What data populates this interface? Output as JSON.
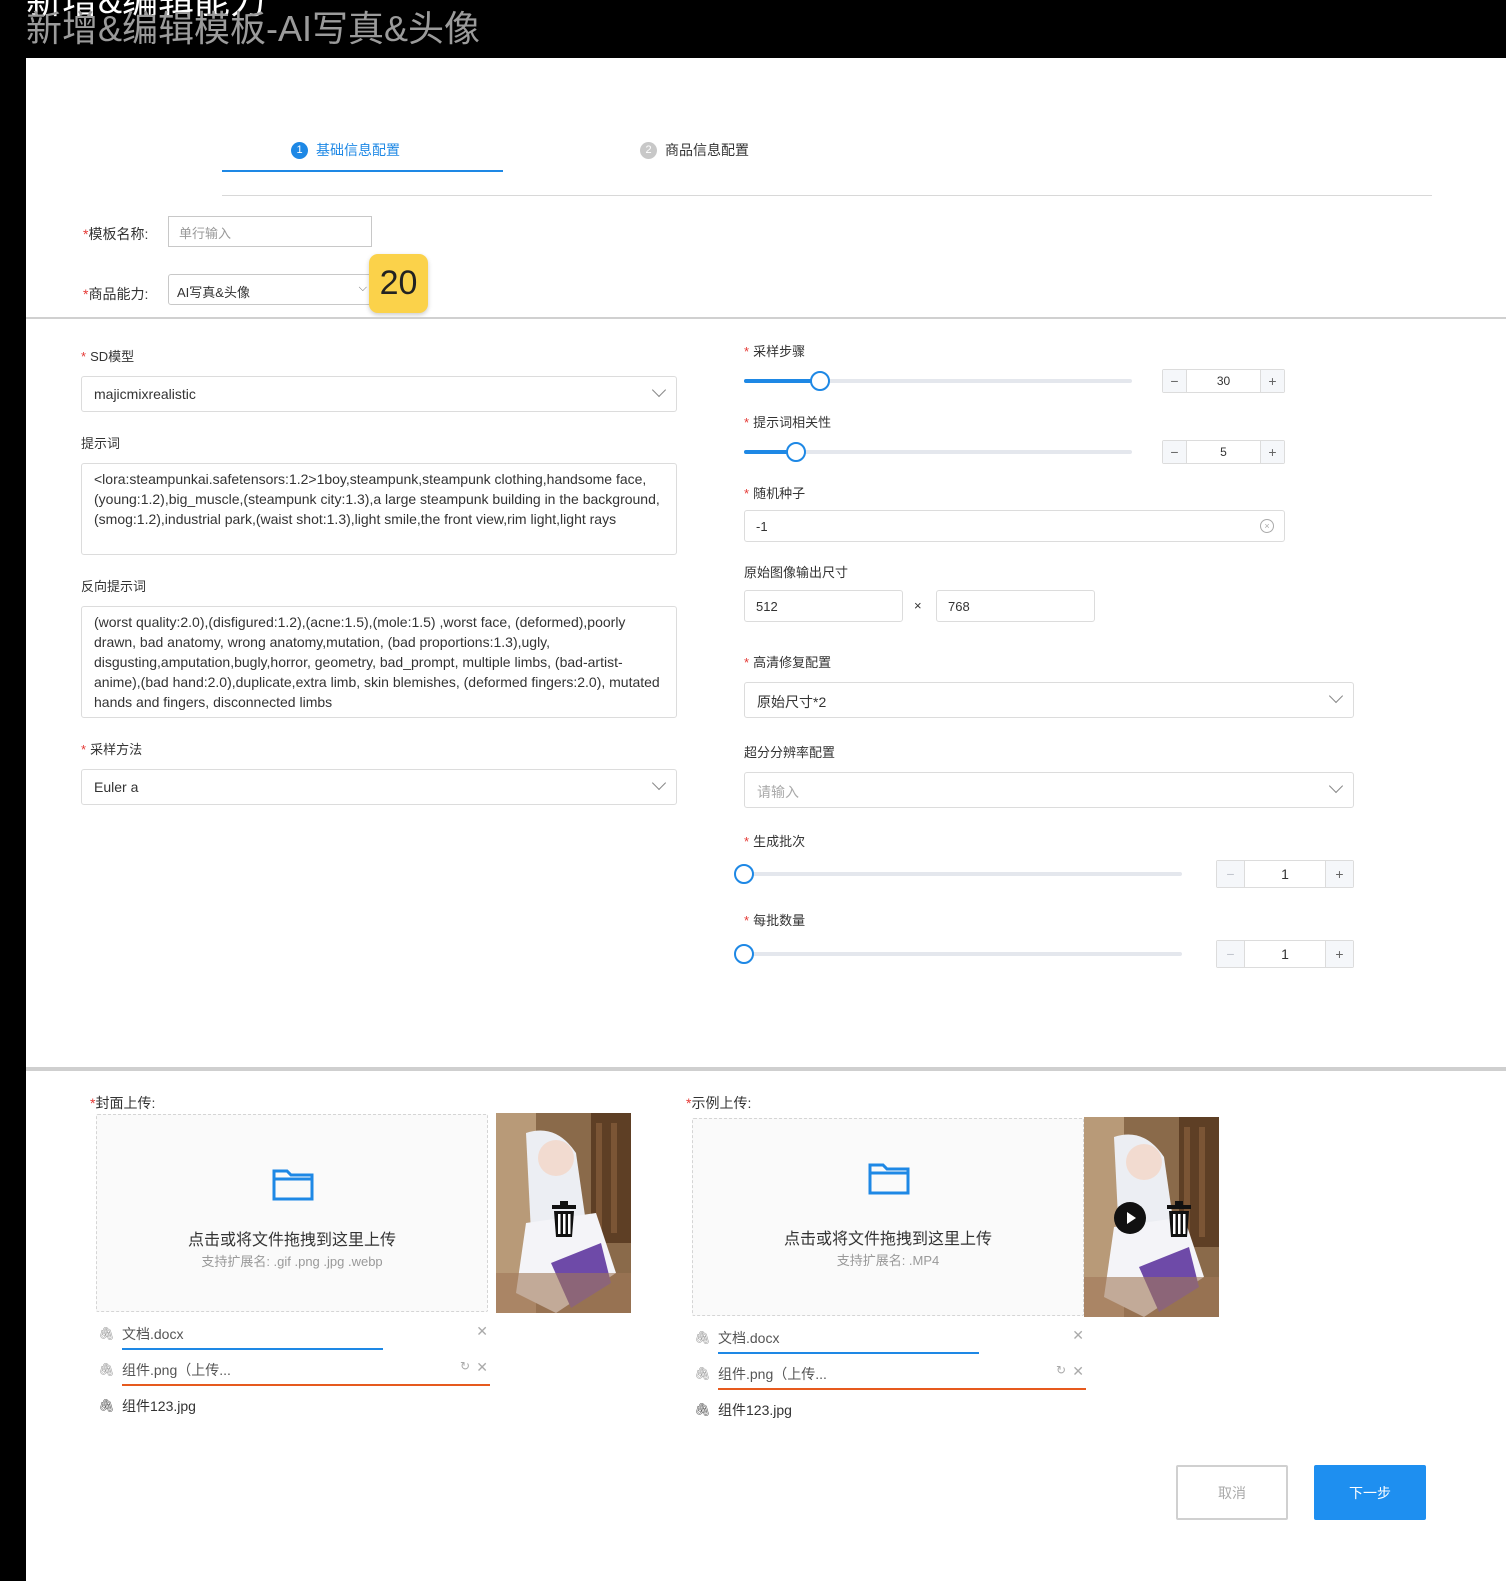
{
  "window": {
    "title_behind": "新增&编辑能力",
    "title": "新增&编辑模板-AI写真&头像"
  },
  "steps": [
    {
      "num": "1",
      "label": "基础信息配置"
    },
    {
      "num": "2",
      "label": "商品信息配置"
    }
  ],
  "form": {
    "template_name_label": "模板名称:",
    "template_name_placeholder": "单行输入",
    "capability_label": "商品能力:",
    "capability_value": "AI写真&头像",
    "badge": "20"
  },
  "params": {
    "sd_model_label": "SD模型",
    "sd_model_value": "majicmixrealistic",
    "prompt_label": "提示词",
    "prompt_value": "<lora:steampunkai.safetensors:1.2>1boy,steampunk,steampunk clothing,handsome face,(young:1.2),big_muscle,(steampunk city:1.3),a large steampunk building in the background,(smog:1.2),industrial park,(waist shot:1.3),light smile,the front view,rim light,light rays",
    "neg_prompt_label": "反向提示词",
    "neg_prompt_value": "(worst quality:2.0),(disfigured:1.2),(acne:1.5),(mole:1.5) ,worst face, (deformed),poorly drawn, bad anatomy, wrong anatomy,mutation, (bad proportions:1.3),ugly, disgusting,amputation,bugly,horror, geometry, bad_prompt, multiple limbs, (bad-artist-anime),(bad hand:2.0),duplicate,extra limb, skin blemishes, (deformed fingers:2.0), mutated hands and fingers, disconnected limbs",
    "sampler_label": "采样方法",
    "sampler_value": "Euler a",
    "steps_label": "采样步骤",
    "steps_value": "30",
    "steps_fraction": 0.195,
    "cfg_label": "提示词相关性",
    "cfg_value": "5",
    "cfg_fraction": 0.135,
    "seed_label": "随机种子",
    "seed_value": "-1",
    "size_label": "原始图像输出尺寸",
    "width_value": "512",
    "height_value": "768",
    "times": "×",
    "hires_label": "高清修复配置",
    "hires_value": "原始尺寸*2",
    "upscale_label": "超分分辨率配置",
    "upscale_placeholder": "请输入",
    "batch_count_label": "生成批次",
    "batch_count_value": "1",
    "batch_count_fraction": 0,
    "batch_size_label": "每批数量",
    "batch_size_value": "1",
    "batch_size_fraction": 0,
    "minus": "−",
    "plus": "+"
  },
  "uploads": {
    "cover_label": "封面上传:",
    "example_label": "示例上传:",
    "dz_title": "点击或将文件拖拽到这里上传",
    "cover_ext": "支持扩展名: .gif .png .jpg .webp",
    "example_ext": "支持扩展名: .MP4",
    "files": [
      {
        "name": "文档.docx"
      },
      {
        "name": "组件.png（上传..."
      },
      {
        "name": "组件123.jpg"
      }
    ]
  },
  "buttons": {
    "cancel": "取消",
    "next": "下一步"
  },
  "colors": {
    "accent": "#1e88e5",
    "required": "#e53935",
    "error_bar": "#e65a1e",
    "badge": "#fbd24a"
  }
}
